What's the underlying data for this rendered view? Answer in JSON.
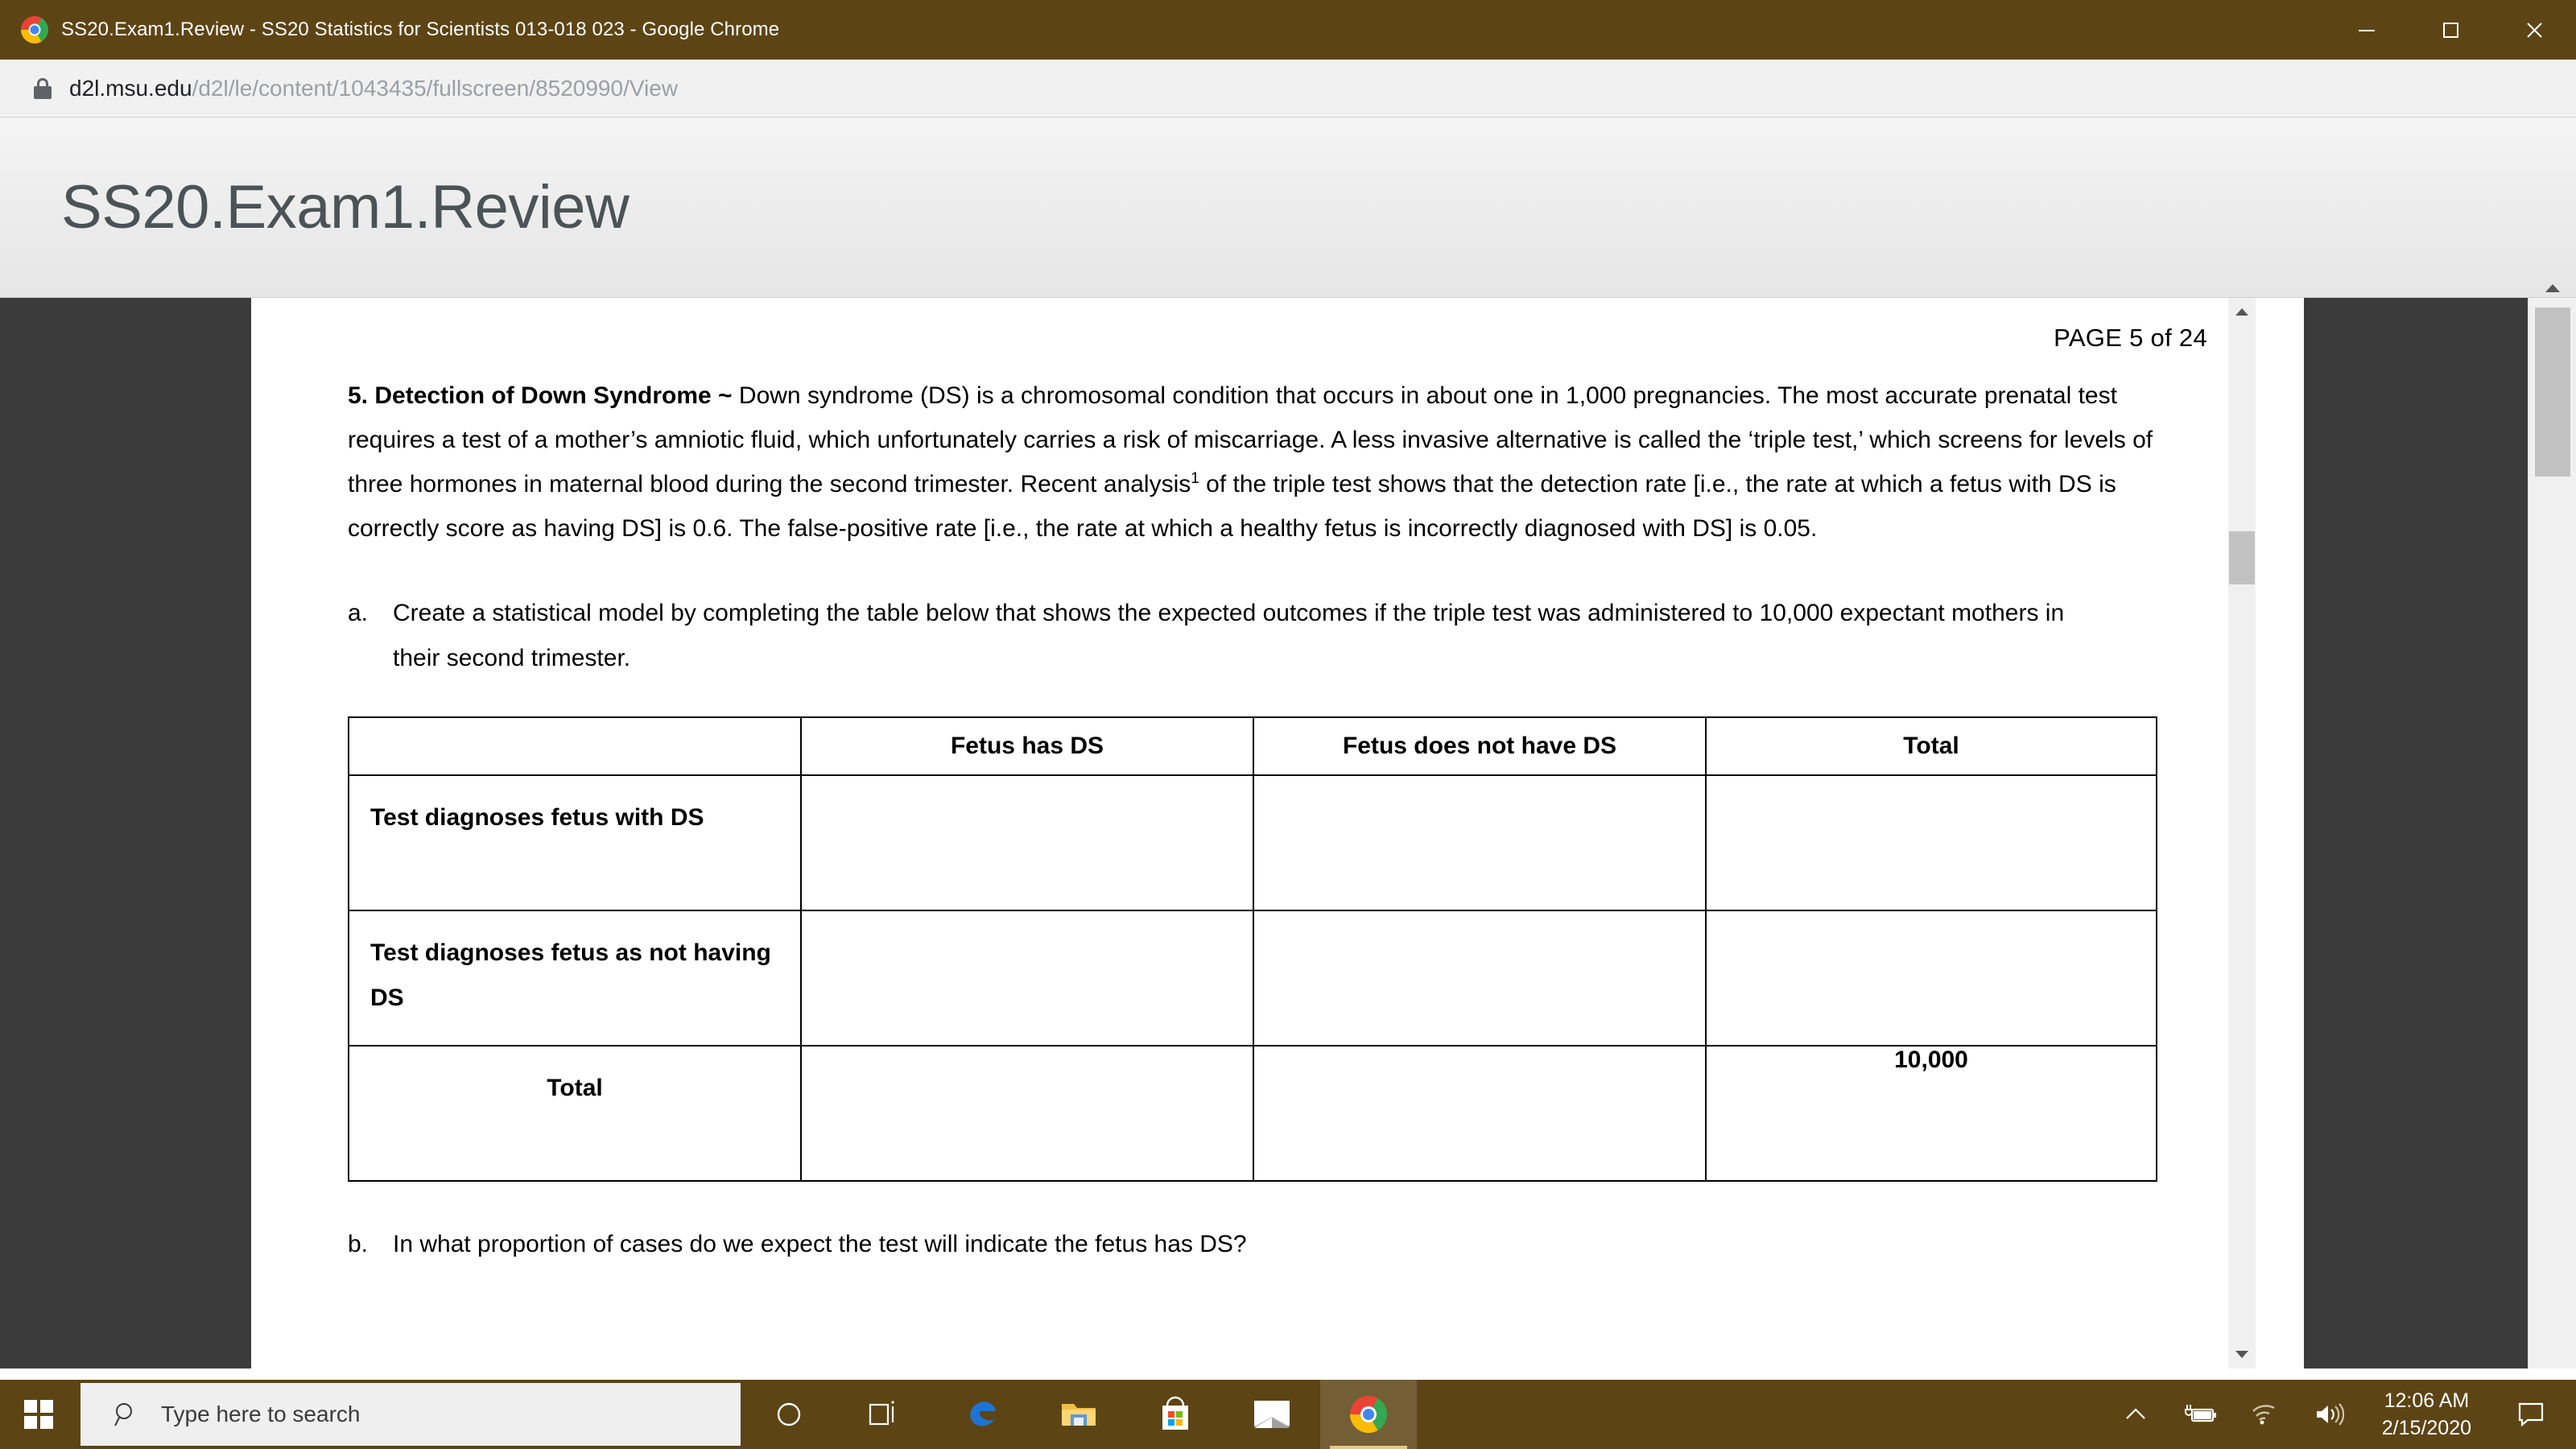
{
  "window": {
    "title": "SS20.Exam1.Review - SS20 Statistics for Scientists 013-018 023 - Google Chrome",
    "titlebar_color": "#5d4415",
    "controls": {
      "minimize": "minimize",
      "maximize": "maximize",
      "close": "close"
    }
  },
  "browser": {
    "lock_icon": "lock-icon",
    "url_host": "d2l.msu.edu",
    "url_path": "/d2l/le/content/1043435/fullscreen/8520990/View"
  },
  "page_header": {
    "title": "SS20.Exam1.Review"
  },
  "document": {
    "page_label": "PAGE  5 of 24",
    "question": {
      "lead_bold": "5. Detection of Down Syndrome ~",
      "body_part1": " Down syndrome (DS) is a chromosomal condition that occurs in about one in 1,000 pregnancies. The most accurate prenatal test requires a test of a mother’s amniotic fluid, which unfortunately carries a risk of miscarriage. A less invasive alternative is called the ‘triple test,’ which screens for levels of three hormones in maternal blood during the second trimester. Recent analysis",
      "footnote_marker": "1",
      "body_part2": " of the triple test shows that the detection rate [i.e., the rate at which a fetus with DS is correctly score as having DS] is 0.6. The false-positive rate [i.e., the rate at which a healthy fetus is incorrectly diagnosed with DS] is 0.05."
    },
    "item_a": {
      "marker": "a.",
      "text": "Create a statistical model by completing the table below that shows the expected outcomes if the triple test was administered to 10,000 expectant mothers in their second trimester."
    },
    "item_b": {
      "marker": "b.",
      "text": "In what proportion of cases do we expect the test will indicate the fetus has DS?"
    },
    "table": {
      "headers": [
        "",
        "Fetus has DS",
        "Fetus does not have DS",
        "Total"
      ],
      "rows": [
        {
          "label": "Test diagnoses fetus with DS",
          "label_align": "left",
          "cells": [
            "",
            "",
            ""
          ]
        },
        {
          "label": "Test diagnoses fetus as not having DS",
          "label_align": "left",
          "cells": [
            "",
            "",
            ""
          ]
        },
        {
          "label": "Total",
          "label_align": "center",
          "cells": [
            "",
            "",
            "10,000"
          ]
        }
      ]
    }
  },
  "scrollbars": {
    "inner": "inner-scrollbar",
    "outer": "page-scrollbar"
  },
  "taskbar": {
    "start": "windows-start",
    "search_placeholder": "Type here to search",
    "search_icon": "search-icon",
    "items": [
      {
        "name": "cortana-icon",
        "label": "Cortana"
      },
      {
        "name": "task-view-icon",
        "label": "Task View"
      },
      {
        "name": "edge-icon",
        "label": "Microsoft Edge"
      },
      {
        "name": "file-explorer-icon",
        "label": "File Explorer"
      },
      {
        "name": "microsoft-store-icon",
        "label": "Microsoft Store"
      },
      {
        "name": "mail-icon",
        "label": "Mail"
      },
      {
        "name": "chrome-icon",
        "label": "Google Chrome"
      }
    ],
    "tray": [
      {
        "name": "show-hidden-icons-icon",
        "label": "Show hidden icons"
      },
      {
        "name": "battery-icon",
        "label": "Battery"
      },
      {
        "name": "wifi-icon",
        "label": "Network"
      },
      {
        "name": "volume-icon",
        "label": "Volume"
      }
    ],
    "clock_time": "12:06 AM",
    "clock_date": "2/15/2020",
    "action_center": "action-center-icon"
  }
}
